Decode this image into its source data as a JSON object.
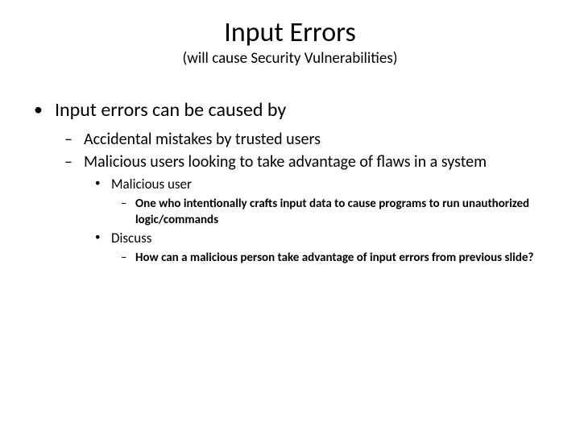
{
  "title": "Input Errors",
  "subtitle": "(will cause Security Vulnerabilities)",
  "l1": {
    "text": "Input errors can be caused by",
    "l2a": "Accidental mistakes by trusted users",
    "l2b": {
      "text": "Malicious users looking to take advantage of flaws in a system",
      "l3a": {
        "text": "Malicious user",
        "l4a": "One who intentionally crafts input data to cause programs to run unauthorized logic/commands"
      },
      "l3b": {
        "text": "Discuss",
        "l4a": "How can a malicious person take advantage of input errors from previous slide?"
      }
    }
  }
}
